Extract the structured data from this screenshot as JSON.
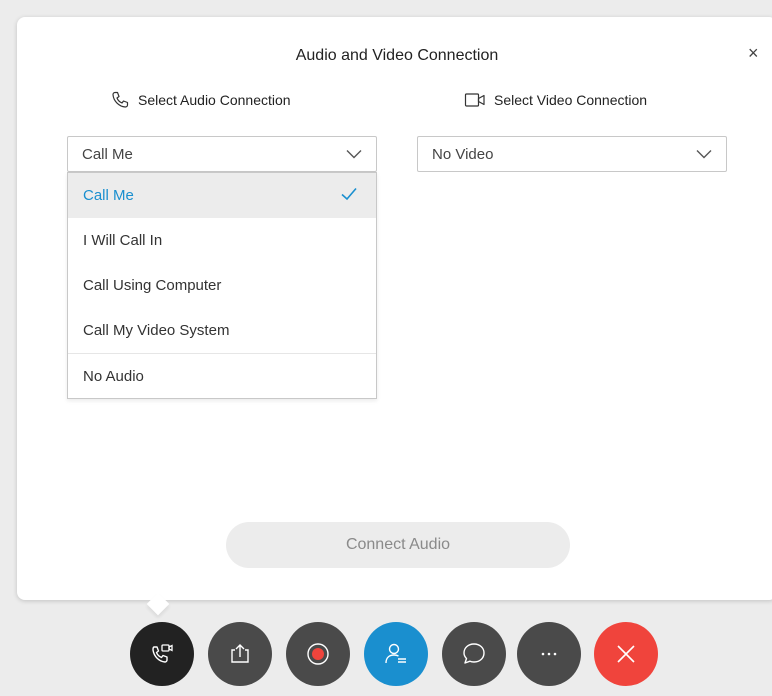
{
  "dialog": {
    "title": "Audio and Video Connection",
    "close_label": "×"
  },
  "audio": {
    "label": "Select Audio Connection",
    "selected": "Call Me",
    "options": [
      "Call Me",
      "I Will Call In",
      "Call Using Computer",
      "Call My Video System",
      "No Audio"
    ]
  },
  "video": {
    "label": "Select Video Connection",
    "selected": "No Video"
  },
  "connect_button": "Connect Audio",
  "toolbar": {
    "buttons": [
      {
        "icon": "audio-video-connection-icon",
        "color": "#222222"
      },
      {
        "icon": "share-icon",
        "color": "#4a4a4a"
      },
      {
        "icon": "record-icon",
        "color": "#4a4a4a"
      },
      {
        "icon": "participants-icon",
        "color": "#1a8fcf"
      },
      {
        "icon": "chat-icon",
        "color": "#4a4a4a"
      },
      {
        "icon": "more-options-icon",
        "color": "#4a4a4a"
      },
      {
        "icon": "end-meeting-icon",
        "color": "#f0443c"
      }
    ]
  },
  "colors": {
    "accent": "#1a8fcf",
    "danger": "#f0443c",
    "dark": "#4a4a4a"
  }
}
